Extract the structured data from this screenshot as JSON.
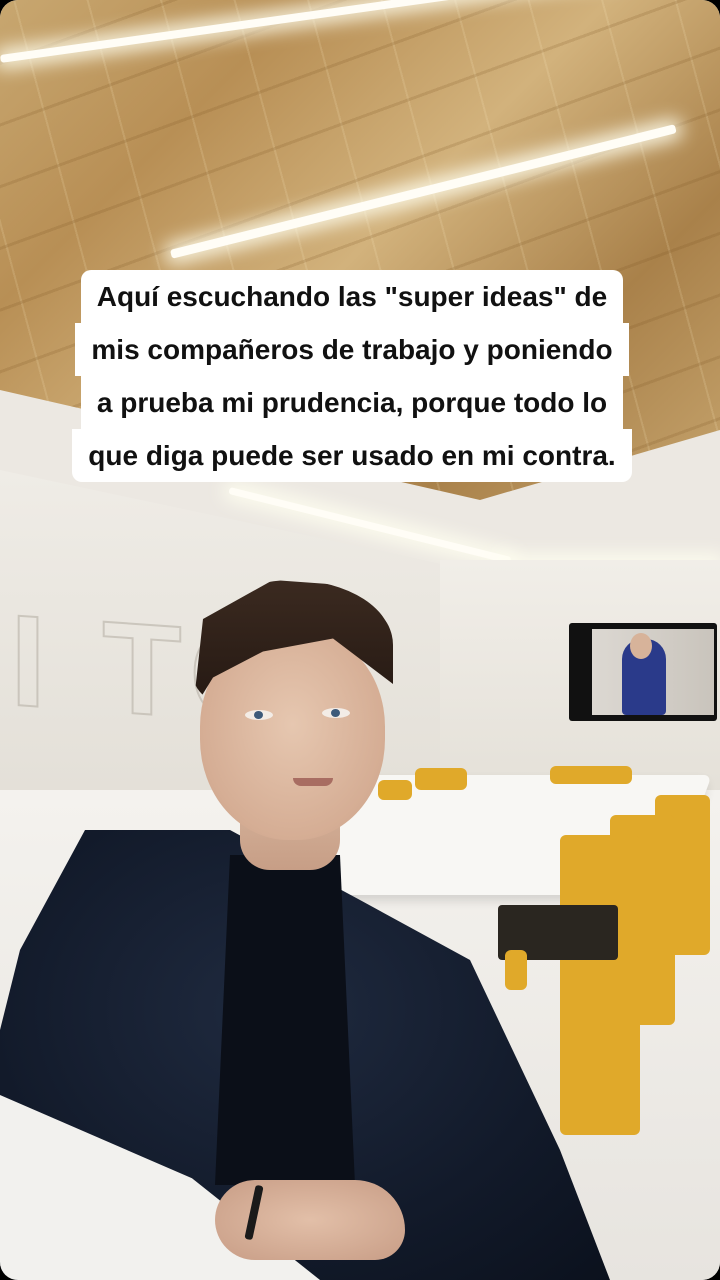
{
  "caption": {
    "lines": [
      "Aquí escuchando las \"super ideas\" de",
      "mis compañeros de trabajo y poniendo",
      "a prueba mi prudencia, porque todo lo",
      "que diga puede ser usado en mi contra."
    ]
  },
  "colors": {
    "caption_background": "#ffffff",
    "caption_text": "#111111",
    "chairs": "#e0a92a",
    "jacket": "#121a2a"
  }
}
